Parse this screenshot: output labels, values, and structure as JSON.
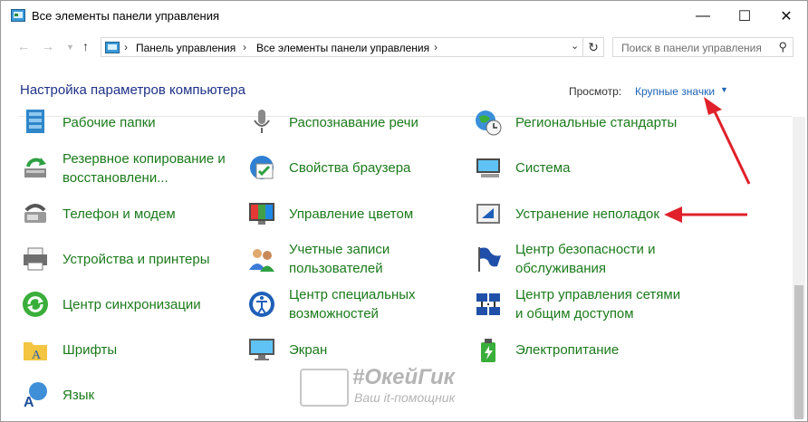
{
  "window": {
    "title": "Все элементы панели управления",
    "minimize_glyph": "—",
    "maximize_glyph": "☐",
    "close_glyph": "✕"
  },
  "address": {
    "back_glyph": "←",
    "forward_glyph": "→",
    "up_glyph": "↑",
    "crumbs": [
      "Панель управления",
      "Все элементы панели управления"
    ],
    "separator": "›",
    "refresh_glyph": "↻"
  },
  "search": {
    "placeholder": "Поиск в панели управления",
    "icon_glyph": "⚲"
  },
  "header": {
    "title": "Настройка параметров компьютера",
    "view_label": "Просмотр:",
    "view_value": "Крупные значки",
    "view_caret": "▼"
  },
  "items": [
    {
      "label": "Рабочие папки",
      "icon": "work-folders-icon"
    },
    {
      "label": "Распознавание речи",
      "icon": "microphone-icon"
    },
    {
      "label": "Региональные стандарты",
      "icon": "globe-clock-icon"
    },
    {
      "label": "Резервное копирование и\nвосстановлени...",
      "icon": "backup-restore-icon"
    },
    {
      "label": "Свойства браузера",
      "icon": "browser-properties-icon"
    },
    {
      "label": "Система",
      "icon": "system-icon"
    },
    {
      "label": "Телефон и модем",
      "icon": "phone-modem-icon"
    },
    {
      "label": "Управление цветом",
      "icon": "color-management-icon"
    },
    {
      "label": "Устранение неполадок",
      "icon": "troubleshooting-icon"
    },
    {
      "label": "Устройства и принтеры",
      "icon": "printer-icon"
    },
    {
      "label": "Учетные записи\nпользователей",
      "icon": "user-accounts-icon"
    },
    {
      "label": "Центр безопасности и\nобслуживания",
      "icon": "flag-icon"
    },
    {
      "label": "Центр синхронизации",
      "icon": "sync-icon"
    },
    {
      "label": "Центр специальных\nвозможностей",
      "icon": "accessibility-icon"
    },
    {
      "label": "Центр управления сетями\nи общим доступом",
      "icon": "network-icon"
    },
    {
      "label": "Шрифты",
      "icon": "fonts-icon"
    },
    {
      "label": "Экран",
      "icon": "display-icon"
    },
    {
      "label": "Электропитание",
      "icon": "power-icon"
    },
    {
      "label": "Язык",
      "icon": "language-icon"
    }
  ],
  "watermark": {
    "title": "#ОкейГик",
    "subtitle": "Ваш it-помощник"
  },
  "colors": {
    "link_green": "#1b7a1b",
    "heading_blue": "#1e3287",
    "view_blue": "#1d64b8",
    "arrow_red": "#e0202a"
  }
}
